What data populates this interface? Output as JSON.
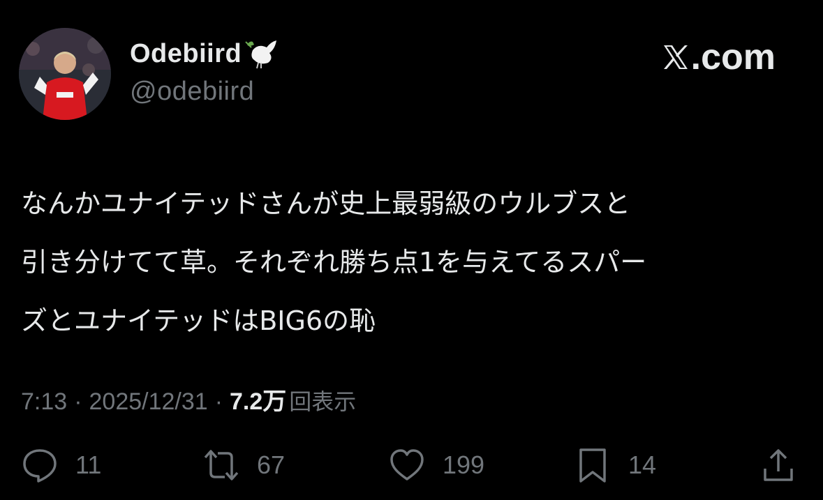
{
  "author": {
    "display_name": "Odebiird",
    "handle": "@odebiird",
    "name_emoji_icon": "dove-with-olive-branch-icon"
  },
  "brand": {
    "label": ".com",
    "logo_icon": "x-logo-icon"
  },
  "tweet": {
    "text": "なんかユナイテッドさんが史上最弱級のウルブスと\n引き分けてて草。それぞれ勝ち点1を与えてるスパー\nズとユナイテッドはBIG6の恥"
  },
  "meta": {
    "time": "7:13",
    "date": "2025/12/31",
    "separator": "·",
    "views_count": "7.2万",
    "views_label": "回表示"
  },
  "actions": {
    "reply": {
      "icon": "reply-icon",
      "count": "11"
    },
    "retweet": {
      "icon": "retweet-icon",
      "count": "67"
    },
    "like": {
      "icon": "heart-icon",
      "count": "199"
    },
    "bookmark": {
      "icon": "bookmark-icon",
      "count": "14"
    },
    "share": {
      "icon": "share-icon"
    }
  },
  "colors": {
    "background": "#000000",
    "primary_text": "#e7e9ea",
    "secondary_text": "#71767b"
  }
}
